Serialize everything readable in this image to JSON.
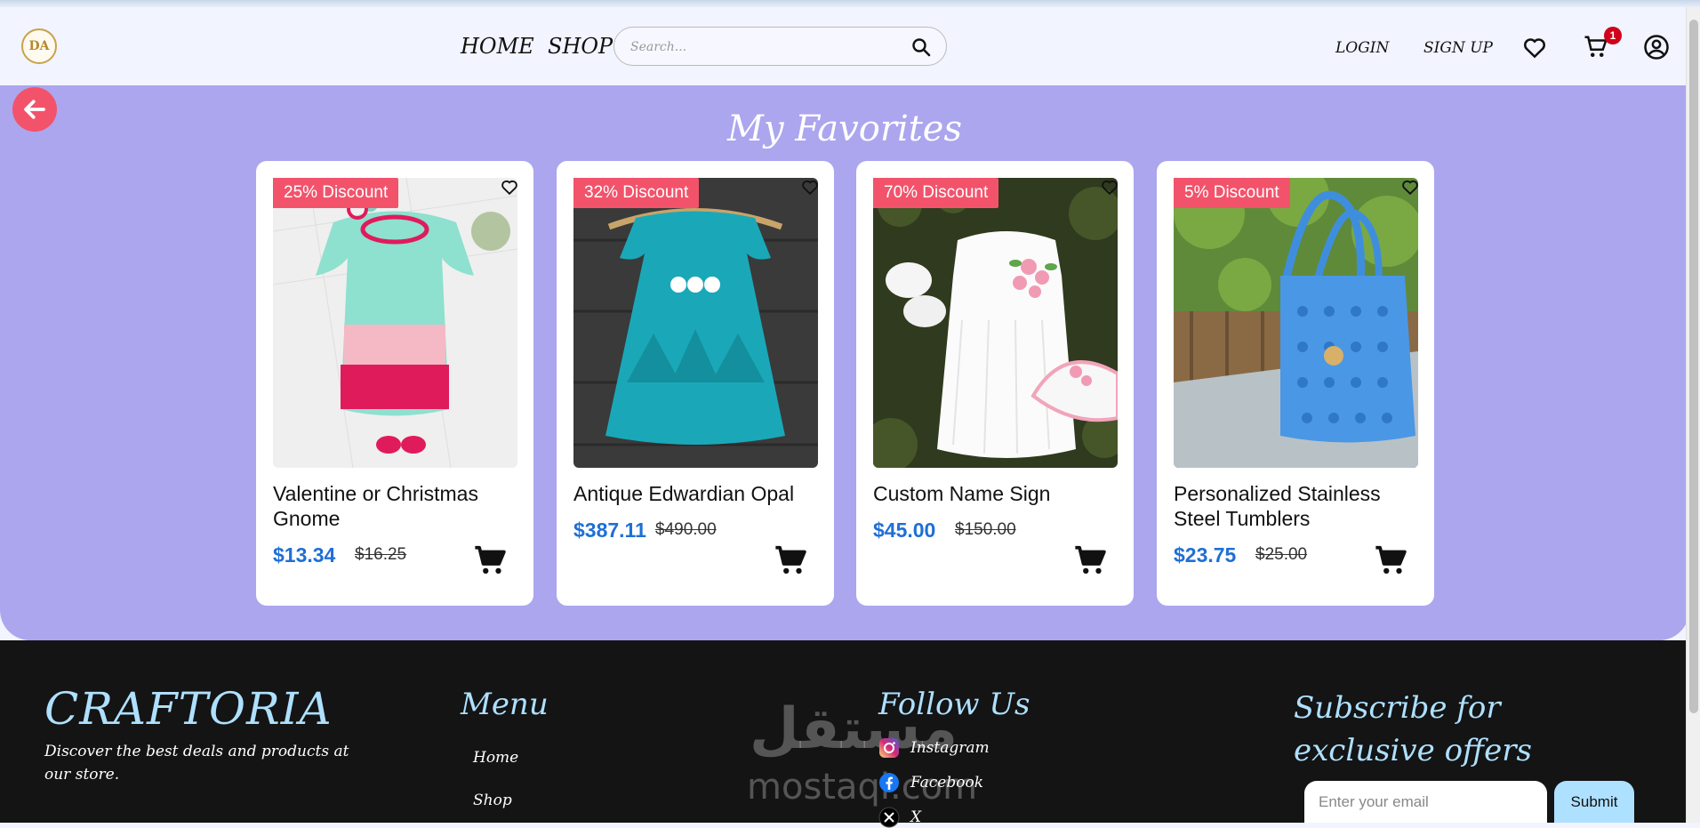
{
  "header": {
    "logo_text": "DA",
    "nav": {
      "home": "HOME",
      "shop": "SHOP"
    },
    "search": {
      "placeholder": "Search..."
    },
    "auth": {
      "login": "LOGIN",
      "signup": "SIGN UP"
    },
    "cart_count": "1"
  },
  "favorites": {
    "title": "My Favorites",
    "cards": [
      {
        "badge": "25% Discount",
        "name": "Valentine or Christmas Gnome",
        "price": "$13.34",
        "old_price": "$16.25",
        "image": "crochet-baby-dress-mint-pink"
      },
      {
        "badge": "32% Discount",
        "name": "Antique Edwardian Opal",
        "price": "$387.11",
        "old_price": "$490.00",
        "image": "crochet-baby-dress-teal"
      },
      {
        "badge": "70% Discount",
        "name": "Custom Name Sign",
        "price": "$45.00",
        "old_price": "$150.00",
        "image": "crochet-baby-dress-white"
      },
      {
        "badge": "5% Discount",
        "name": "Personalized Stainless Steel Tumblers",
        "price": "$23.75",
        "old_price": "$25.00",
        "image": "crochet-blue-tote-bag"
      }
    ]
  },
  "footer": {
    "brand": "CRAFTORIA",
    "description": "Discover the best deals and products at our store.",
    "menu": {
      "title": "Menu",
      "items": [
        "Home",
        "Shop"
      ]
    },
    "follow": {
      "title": "Follow Us",
      "items": [
        "Instagram",
        "Facebook",
        "X"
      ]
    },
    "subscribe": {
      "title": "Subscribe for exclusive offers",
      "email_placeholder": "Enter your email",
      "submit": "Submit"
    },
    "watermark": {
      "arabic": "مستقل",
      "latin": "mostaql.com"
    }
  },
  "colors": {
    "accent_red": "#f2536b",
    "section_purple": "#aba6ee",
    "price_blue": "#1f6fd6",
    "footer_bg": "#141414",
    "footer_heading": "#aee0ff"
  }
}
